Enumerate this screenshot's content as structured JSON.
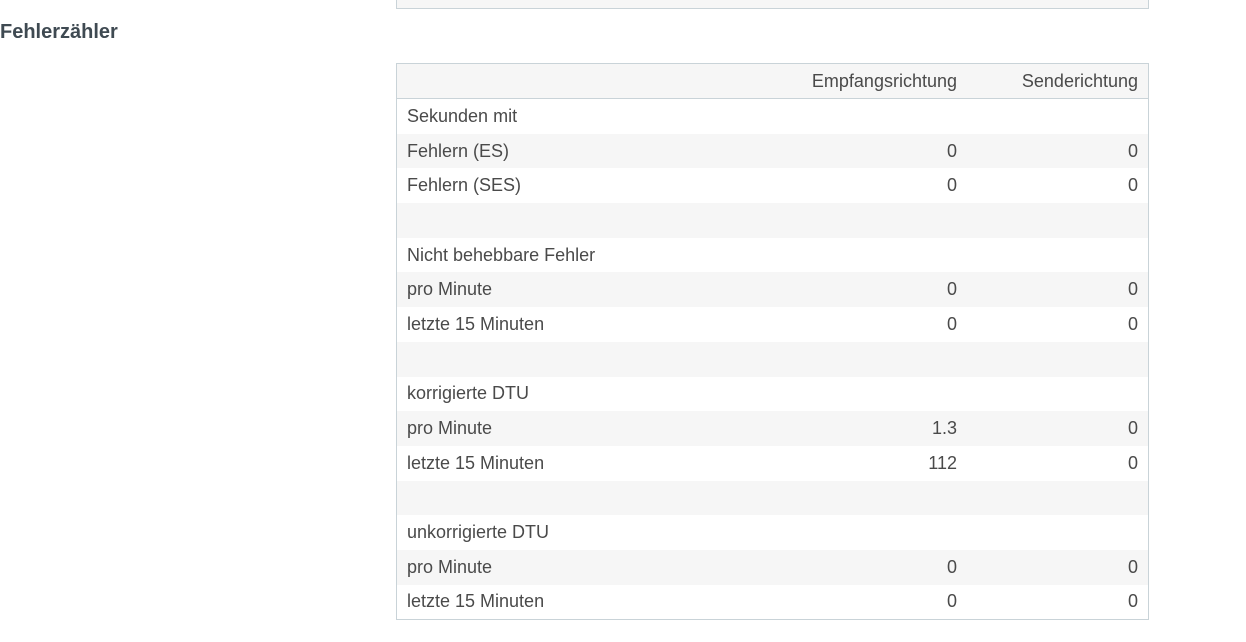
{
  "section": {
    "title": "Fehlerzähler"
  },
  "table": {
    "headers": {
      "label": "",
      "rx": "Empfangsrichtung",
      "tx": "Senderichtung"
    },
    "rows": [
      {
        "label": "Sekunden mit",
        "rx": "",
        "tx": ""
      },
      {
        "label": "Fehlern (ES)",
        "rx": "0",
        "tx": "0"
      },
      {
        "label": "Fehlern (SES)",
        "rx": "0",
        "tx": "0"
      },
      {
        "label": "",
        "rx": "",
        "tx": ""
      },
      {
        "label": "Nicht behebbare Fehler",
        "rx": "",
        "tx": ""
      },
      {
        "label": "pro Minute",
        "rx": "0",
        "tx": "0"
      },
      {
        "label": "letzte 15 Minuten",
        "rx": "0",
        "tx": "0"
      },
      {
        "label": "",
        "rx": "",
        "tx": ""
      },
      {
        "label": "korrigierte DTU",
        "rx": "",
        "tx": ""
      },
      {
        "label": "pro Minute",
        "rx": "1.3",
        "tx": "0"
      },
      {
        "label": "letzte 15 Minuten",
        "rx": "112",
        "tx": "0"
      },
      {
        "label": "",
        "rx": "",
        "tx": ""
      },
      {
        "label": "unkorrigierte DTU",
        "rx": "",
        "tx": ""
      },
      {
        "label": "pro Minute",
        "rx": "0",
        "tx": "0"
      },
      {
        "label": "letzte 15 Minuten",
        "rx": "0",
        "tx": "0"
      }
    ]
  }
}
